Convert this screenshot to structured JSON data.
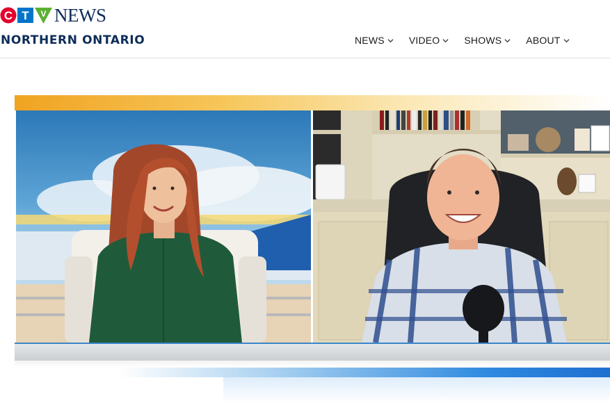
{
  "brand": {
    "logo_letters": [
      "C",
      "T",
      "V"
    ],
    "wordmark": "NEWS",
    "region": "NORTHERN ONTARIO",
    "colors": {
      "red": "#e4002b",
      "blue": "#0075c9",
      "green": "#5ab031",
      "navy": "#0d2d59"
    }
  },
  "nav": {
    "items": [
      {
        "label": "NEWS",
        "icon": "chevron-down-icon"
      },
      {
        "label": "VIDEO",
        "icon": "chevron-down-icon"
      },
      {
        "label": "SHOWS",
        "icon": "chevron-down-icon"
      },
      {
        "label": "ABOUT",
        "icon": "chevron-down-icon"
      }
    ]
  },
  "video": {
    "layout": "split-screen interview",
    "left_panel": "studio host in green blouse seated in white armchair",
    "right_panel": "remote guest in plaid shirt with microphone, bookshelf background"
  }
}
